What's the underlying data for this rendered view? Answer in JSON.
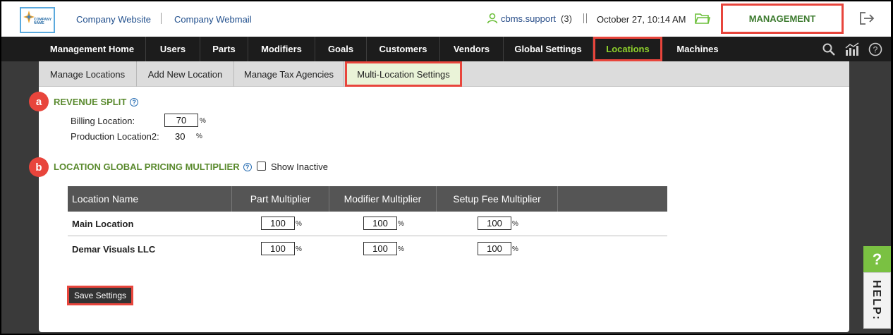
{
  "header": {
    "logo_text": "COMPANY NAME",
    "links": [
      "Company Website",
      "Company Webmail"
    ],
    "user": "cbms.support",
    "user_count": "(3)",
    "datetime": "October 27, 10:14 AM",
    "management_label": "MANAGEMENT"
  },
  "nav": {
    "items": [
      "Management Home",
      "Users",
      "Parts",
      "Modifiers",
      "Goals",
      "Customers",
      "Vendors",
      "Global Settings",
      "Locations",
      "Machines"
    ],
    "active": "Locations"
  },
  "subtabs": {
    "items": [
      "Manage Locations",
      "Add New Location",
      "Manage Tax Agencies",
      "Multi-Location Settings"
    ],
    "active": "Multi-Location Settings"
  },
  "revenue_split": {
    "badge": "a",
    "title": "REVENUE SPLIT",
    "billing_label": "Billing Location:",
    "billing_value": "70",
    "production_label": "Production Location2:",
    "production_value": "30",
    "pct": "%"
  },
  "pricing": {
    "badge": "b",
    "title": "LOCATION GLOBAL PRICING MULTIPLIER",
    "show_inactive_label": "Show Inactive",
    "columns": [
      "Location Name",
      "Part Multiplier",
      "Modifier Multiplier",
      "Setup Fee Multiplier"
    ],
    "rows": [
      {
        "name": "Main Location",
        "part": "100",
        "modifier": "100",
        "setup": "100"
      },
      {
        "name": "Demar Visuals LLC",
        "part": "100",
        "modifier": "100",
        "setup": "100"
      }
    ]
  },
  "save_label": "Save Settings",
  "help": {
    "q": "?",
    "label": "HELP:"
  },
  "colors": {
    "accent_green": "#5a8a2e",
    "highlight_red": "#e8453c",
    "nav_bg": "#1c1c1c",
    "active_nav": "#8fd12c"
  }
}
